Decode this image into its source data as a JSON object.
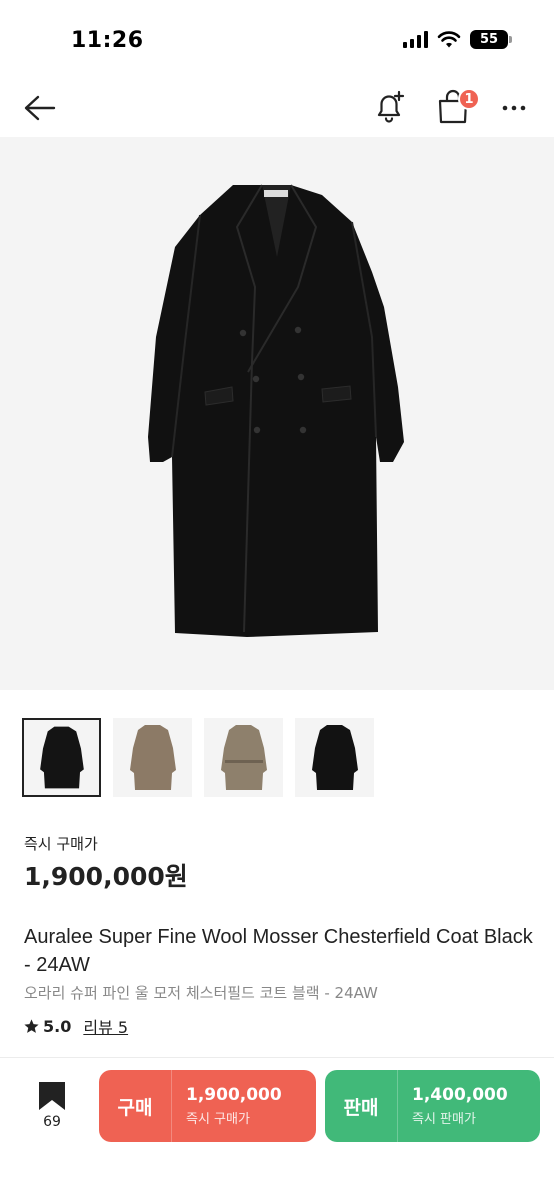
{
  "status_bar": {
    "time": "11:26",
    "battery": "55"
  },
  "nav": {
    "back_icon": "arrow-left-icon",
    "bell_icon": "bell-plus-icon",
    "bag_icon": "shopping-bag-icon",
    "bag_badge": "1",
    "more_icon": "more-horizontal-icon"
  },
  "product": {
    "image_icon": "black-coat-image",
    "thumbnails": [
      {
        "name": "black coat",
        "color": "#141414",
        "selected": true
      },
      {
        "name": "taupe coat",
        "color": "#8c7a66",
        "selected": false
      },
      {
        "name": "taupe belted coat",
        "color": "#8e806c",
        "selected": false
      },
      {
        "name": "black belted coat",
        "color": "#121212",
        "selected": false
      }
    ],
    "instant_label": "즉시 구매가",
    "price": "1,900,000원",
    "title_en": "Auralee Super Fine Wool Mosser Chesterfield Coat Black - 24AW",
    "title_ko": "오라리 슈퍼 파인 울 모저 체스터필드 코트 블랙 - 24AW",
    "rating": "5.0",
    "review_label": "리뷰 5"
  },
  "bottom_bar": {
    "bookmark_count": "69",
    "buy": {
      "label": "구매",
      "price": "1,900,000",
      "sub": "즉시 구매가"
    },
    "sell": {
      "label": "판매",
      "price": "1,400,000",
      "sub": "즉시 판매가"
    }
  },
  "colors": {
    "buy": "#ef6253",
    "sell": "#41b979",
    "badge": "#ef6253"
  }
}
